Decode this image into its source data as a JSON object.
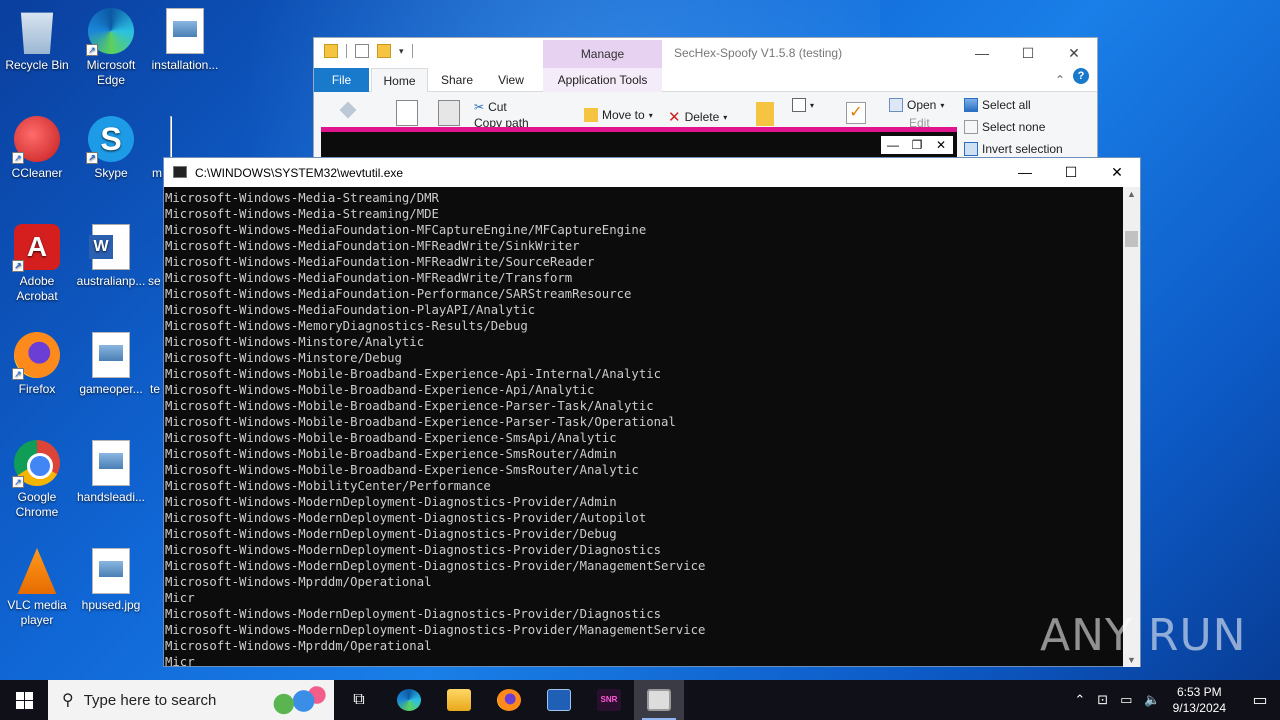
{
  "desktop": {
    "icons": [
      {
        "label": "Recycle Bin"
      },
      {
        "label": "Microsoft Edge"
      },
      {
        "label": "installation..."
      },
      {
        "label": "CCleaner"
      },
      {
        "label": "Skype"
      },
      {
        "label": "m"
      },
      {
        "label": "Adobe Acrobat"
      },
      {
        "label": "australianp..."
      },
      {
        "label": "se"
      },
      {
        "label": "Firefox"
      },
      {
        "label": "gameoper..."
      },
      {
        "label": "te"
      },
      {
        "label": "Google Chrome"
      },
      {
        "label": "handsleadi..."
      },
      {
        "label": "VLC media player"
      },
      {
        "label": "hpused.jpg"
      }
    ]
  },
  "explorer": {
    "title": "SecHex-Spoofy V1.5.8 (testing)",
    "manage_tab": "Manage",
    "tabs": {
      "file": "File",
      "home": "Home",
      "share": "Share",
      "view": "View",
      "app_tools": "Application Tools"
    },
    "ribbon": {
      "cut": "Cut",
      "copy_path": "Copy path",
      "move_to": "Move to",
      "delete": "Delete",
      "open": "Open",
      "edit": "Edit",
      "select_all": "Select all",
      "select_none": "Select none",
      "invert_selection": "Invert selection"
    },
    "help": "?"
  },
  "console": {
    "title": "C:\\WINDOWS\\SYSTEM32\\wevtutil.exe",
    "lines": [
      "Microsoft-Windows-Media-Streaming/DMR",
      "Microsoft-Windows-Media-Streaming/MDE",
      "Microsoft-Windows-MediaFoundation-MFCaptureEngine/MFCaptureEngine",
      "Microsoft-Windows-MediaFoundation-MFReadWrite/SinkWriter",
      "Microsoft-Windows-MediaFoundation-MFReadWrite/SourceReader",
      "Microsoft-Windows-MediaFoundation-MFReadWrite/Transform",
      "Microsoft-Windows-MediaFoundation-Performance/SARStreamResource",
      "Microsoft-Windows-MediaFoundation-PlayAPI/Analytic",
      "Microsoft-Windows-MemoryDiagnostics-Results/Debug",
      "Microsoft-Windows-Minstore/Analytic",
      "Microsoft-Windows-Minstore/Debug",
      "Microsoft-Windows-Mobile-Broadband-Experience-Api-Internal/Analytic",
      "Microsoft-Windows-Mobile-Broadband-Experience-Api/Analytic",
      "Microsoft-Windows-Mobile-Broadband-Experience-Parser-Task/Analytic",
      "Microsoft-Windows-Mobile-Broadband-Experience-Parser-Task/Operational",
      "Microsoft-Windows-Mobile-Broadband-Experience-SmsApi/Analytic",
      "Microsoft-Windows-Mobile-Broadband-Experience-SmsRouter/Admin",
      "Microsoft-Windows-Mobile-Broadband-Experience-SmsRouter/Analytic",
      "Microsoft-Windows-MobilityCenter/Performance",
      "Microsoft-Windows-ModernDeployment-Diagnostics-Provider/Admin",
      "Microsoft-Windows-ModernDeployment-Diagnostics-Provider/Autopilot",
      "Microsoft-Windows-ModernDeployment-Diagnostics-Provider/Debug",
      "Microsoft-Windows-ModernDeployment-Diagnostics-Provider/Diagnostics",
      "Microsoft-Windows-ModernDeployment-Diagnostics-Provider/ManagementService",
      "Microsoft-Windows-Mprddm/Operational",
      "Micr",
      "Microsoft-Windows-ModernDeployment-Diagnostics-Provider/Diagnostics",
      "Microsoft-Windows-ModernDeployment-Diagnostics-Provider/ManagementService",
      "Microsoft-Windows-Mprddm/Operational",
      "Micr"
    ]
  },
  "watermark": "ANY RUN",
  "taskbar": {
    "search_placeholder": "Type here to search",
    "time": "6:53 PM",
    "date": "9/13/2024",
    "apps": [
      "task-view-icon",
      "edge-icon",
      "file-explorer-icon",
      "firefox-icon",
      "app-icon",
      "snr-icon",
      "cmd-icon"
    ]
  }
}
